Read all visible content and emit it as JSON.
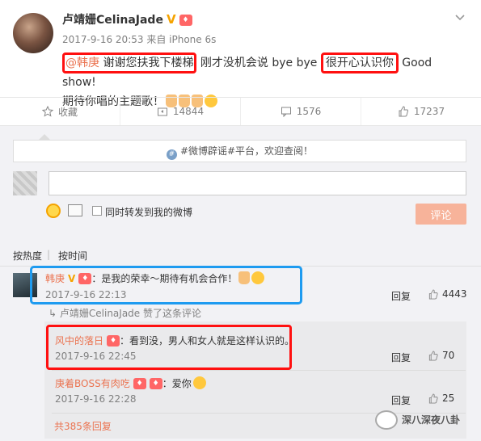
{
  "post": {
    "author": "卢靖姗CelinaJade",
    "verified_badge": "V",
    "timestamp": "2017-9-16 20:53",
    "source": "来自 iPhone 6s",
    "mention": "@韩庚",
    "text_part1": "谢谢您扶我下楼梯",
    "text_part2": "刚才没机会说 bye bye",
    "text_part3": "很开心认识你",
    "text_part4": "Good show!",
    "text_part5": "期待你唱的主题歌！"
  },
  "actions": {
    "favorite_label": "收藏",
    "repost_count": "14844",
    "comment_count": "1576",
    "like_count": "17237"
  },
  "comment_box": {
    "notice": "#微博辟谣#平台，欢迎查阅！",
    "forward_label": "同时转发到我的微博",
    "submit_label": "评论"
  },
  "sort": {
    "hot": "按热度",
    "time": "按时间"
  },
  "comments": [
    {
      "name": "韩庚",
      "text": "：是我的荣幸～期待有机会合作！",
      "time": "2017-9-16 22:13",
      "reply": "回复",
      "likes": "4443",
      "liked_note": "卢靖姗CelinaJade 赞了这条评论"
    }
  ],
  "replies": [
    {
      "name": "风中的落日",
      "text": "：看到没，男人和女人就是这样认识的。",
      "time": "2017-9-16 22:45",
      "reply": "回复",
      "likes": "70"
    },
    {
      "name": "庚着BOSS有肉吃",
      "text": "：爱你",
      "time": "2017-9-16 22:28",
      "reply": "回复",
      "likes": "25"
    }
  ],
  "more_replies": "共385条回复",
  "watermark": "深八深夜八卦",
  "colors": {
    "accent": "#eb7350",
    "highlight_red": "#ff1010",
    "highlight_blue": "#1e9bf0"
  }
}
